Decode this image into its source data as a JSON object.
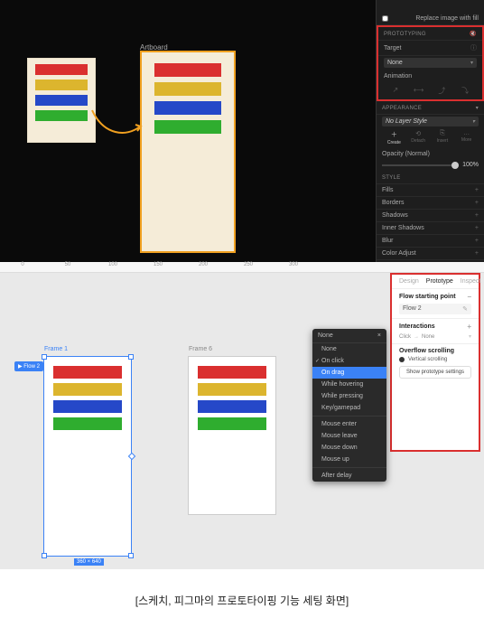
{
  "sketch": {
    "artboard_label": "Artboard",
    "panel": {
      "replace_label": "Replace image with fill",
      "prototyping_header": "PROTOTYPING",
      "target_label": "Target",
      "target_value": "None",
      "animation_label": "Animation",
      "appearance_header": "APPEARANCE",
      "layer_style_value": "No Layer Style",
      "action_create": "Create",
      "action_detach": "Detach",
      "action_insert": "Insert",
      "action_more": "More",
      "opacity_label": "Opacity (Normal)",
      "opacity_value": "100%",
      "style_header": "STYLE",
      "sections": [
        "Fills",
        "Borders",
        "Shadows",
        "Inner Shadows",
        "Blur",
        "Color Adjust"
      ]
    }
  },
  "figma": {
    "ruler_ticks": [
      "0",
      "50",
      "100",
      "150",
      "200",
      "250",
      "300"
    ],
    "frame1_label": "Frame 1",
    "frame2_label": "Frame 6",
    "flow_badge": "Flow 2",
    "dim_badge": "360 × 640",
    "popup": {
      "title": "None",
      "items": [
        "None",
        "On click",
        "On drag",
        "While hovering",
        "While pressing",
        "Key/gamepad"
      ],
      "items2": [
        "Mouse enter",
        "Mouse leave",
        "Mouse down",
        "Mouse up"
      ],
      "items3": [
        "After delay"
      ],
      "checked": "On click",
      "selected": "On drag"
    },
    "panel": {
      "tabs": [
        "Design",
        "Prototype",
        "Inspect"
      ],
      "flow_title": "Flow starting point",
      "flow_value": "Flow 2",
      "interactions_title": "Interactions",
      "int_trigger": "Click",
      "int_action": "None",
      "overflow_title": "Overflow scrolling",
      "overflow_value": "Vertical scrolling",
      "show_settings": "Show prototype settings"
    }
  },
  "caption": "[스케치, 피그마의 프로토타이핑 기능 세팅 화면]"
}
